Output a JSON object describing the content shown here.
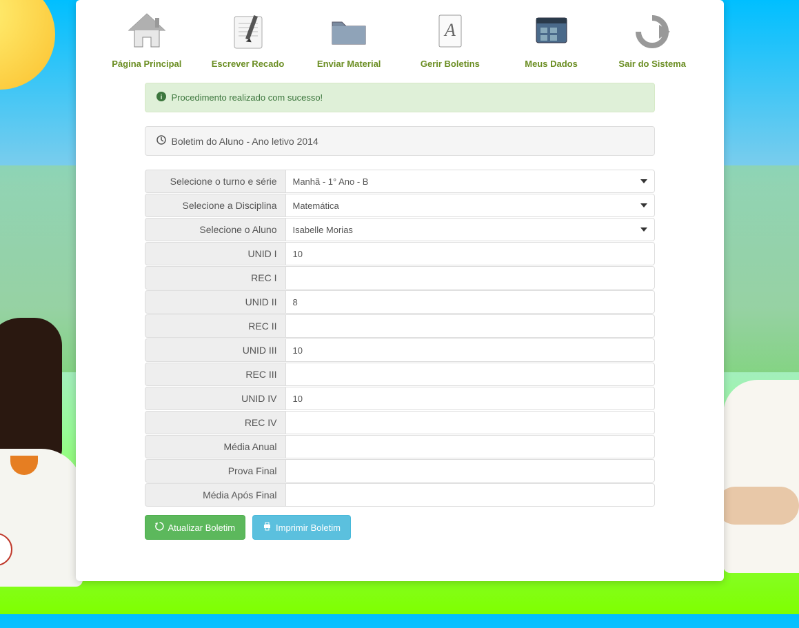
{
  "nav": [
    {
      "label": "Página Principal",
      "icon": "home-icon"
    },
    {
      "label": "Escrever Recado",
      "icon": "write-icon"
    },
    {
      "label": "Enviar Material",
      "icon": "folder-icon"
    },
    {
      "label": "Gerir Boletins",
      "icon": "document-icon"
    },
    {
      "label": "Meus Dados",
      "icon": "data-icon"
    },
    {
      "label": "Sair do Sistema",
      "icon": "logout-icon"
    }
  ],
  "alert": {
    "message": "Procedimento realizado com sucesso!"
  },
  "panel": {
    "title": "Boletim do Aluno - Ano letivo 2014"
  },
  "form": {
    "turno_label": "Selecione o turno e série",
    "turno_value": "Manhã - 1° Ano - B",
    "disciplina_label": "Selecione a Disciplina",
    "disciplina_value": "Matemática",
    "aluno_label": "Selecione o Aluno",
    "aluno_value": "Isabelle Morias",
    "fields": [
      {
        "label": "UNID I",
        "value": "10"
      },
      {
        "label": "REC I",
        "value": ""
      },
      {
        "label": "UNID II",
        "value": "8"
      },
      {
        "label": "REC II",
        "value": ""
      },
      {
        "label": "UNID III",
        "value": "10"
      },
      {
        "label": "REC III",
        "value": ""
      },
      {
        "label": "UNID IV",
        "value": "10"
      },
      {
        "label": "REC IV",
        "value": ""
      },
      {
        "label": "Média Anual",
        "value": ""
      },
      {
        "label": "Prova Final",
        "value": ""
      },
      {
        "label": "Média Após Final",
        "value": ""
      }
    ]
  },
  "buttons": {
    "update": "Atualizar Boletim",
    "print": "Imprimir Boletim"
  }
}
